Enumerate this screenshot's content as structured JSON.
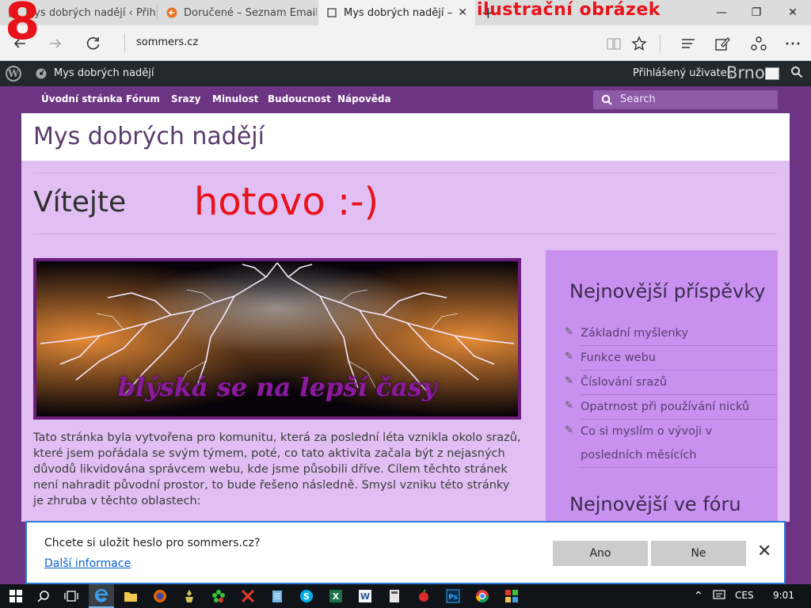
{
  "browser": {
    "tabs": [
      {
        "title": "Mys dobrých nadějí ‹ Přihlás",
        "active": false
      },
      {
        "title": "Doručené – Seznam Email",
        "active": false
      },
      {
        "title": "Mys dobrých nadějí – N",
        "active": true
      }
    ],
    "tab_close": "✕",
    "new_tab": "+",
    "window_controls": {
      "minimize": "—",
      "restore": "❐",
      "close": "✕"
    },
    "address": "sommers.cz",
    "icons": [
      "back-icon",
      "forward-icon",
      "refresh-icon",
      "reading-view-icon",
      "favorite-star-icon",
      "hub-icon",
      "web-note-icon",
      "share-icon",
      "more-icon"
    ]
  },
  "overlays": {
    "number": "8",
    "caption": "ilustrační obrázek",
    "done": "hotovo :-)"
  },
  "adminbar": {
    "site_name": "Mys dobrých nadějí",
    "howdy": "Přihlášený uživatel:",
    "username": "Brno"
  },
  "site": {
    "menu": [
      "Úvodní stránka",
      "Fórum",
      "Srazy",
      "Minulost",
      "Budoucnost",
      "Nápověda"
    ],
    "search_placeholder": "Search",
    "title": "Mys dobrých nadějí",
    "page_title": "Vítejte",
    "banner_text": "blýská se na lepší časy",
    "intro": "Tato stránka byla vytvořena pro komunitu, která za poslední léta vznikla okolo srazů, které jsem pořádala se svým týmem, poté, co tato aktivita začala být z nejasných důvodů likvidována správcem webu, kde jsme působili dříve. Cílem těchto stránek není nahradit původní prostor, to bude řešeno následně. Smysl vzniku této stránky je zhruba v těchto oblastech:"
  },
  "sidebar": {
    "recent_posts_title": "Nejnovější příspěvky",
    "recent_posts": [
      "Základní myšlenky",
      "Funkce webu",
      "Číslování srazů",
      "Opatrnost při používání nicků",
      "Co si myslím o vývoji v posledních měsících"
    ],
    "forum_title": "Nejnovější ve fóru"
  },
  "password_prompt": {
    "question": "Chcete si uložit heslo pro sommers.cz?",
    "more": "Další informace",
    "yes": "Ano",
    "no": "Ne",
    "close": "✕"
  },
  "taskbar": {
    "language": "CES",
    "time": "9:01"
  },
  "colors": {
    "accent_purple": "#6c3483",
    "page_bg": "#e1bff3",
    "sidebar_bg": "#c891ef",
    "overlay_red": "#e8121a",
    "prompt_border": "#2d7ad6"
  }
}
